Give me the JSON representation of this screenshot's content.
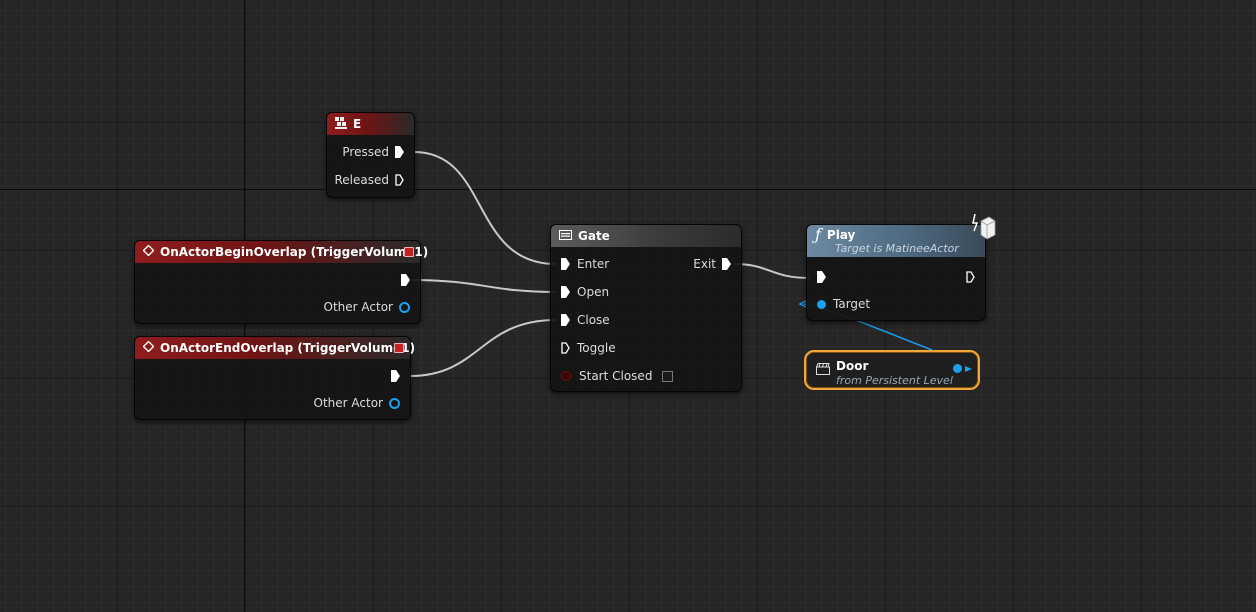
{
  "colors": {
    "event_header": "#8f1d1d",
    "function_header": "#6c8aa3",
    "object_pin": "#1aa1f2",
    "selection_outline": "#f3a63a"
  },
  "key_node": {
    "title": "E",
    "icon": "keyboard-icon",
    "pins": [
      "Pressed",
      "Released"
    ]
  },
  "begin_overlap": {
    "title": "OnActorBeginOverlap (TriggerVolume1)",
    "icon": "event-diamond-icon",
    "pin": "Other Actor"
  },
  "end_overlap": {
    "title": "OnActorEndOverlap (TriggerVolume1)",
    "icon": "event-diamond-icon",
    "pin": "Other Actor"
  },
  "gate": {
    "title": "Gate",
    "icon": "gate-icon",
    "inputs": [
      "Enter",
      "Open",
      "Close",
      "Toggle"
    ],
    "output": "Exit",
    "start_closed": "Start Closed"
  },
  "play": {
    "title": "Play",
    "icon": "function-icon",
    "subtitle": "Target is MatineeActor",
    "target": "Target"
  },
  "door": {
    "title": "Door",
    "subtitle": "from Persistent Level",
    "icon": "matinee-icon"
  }
}
